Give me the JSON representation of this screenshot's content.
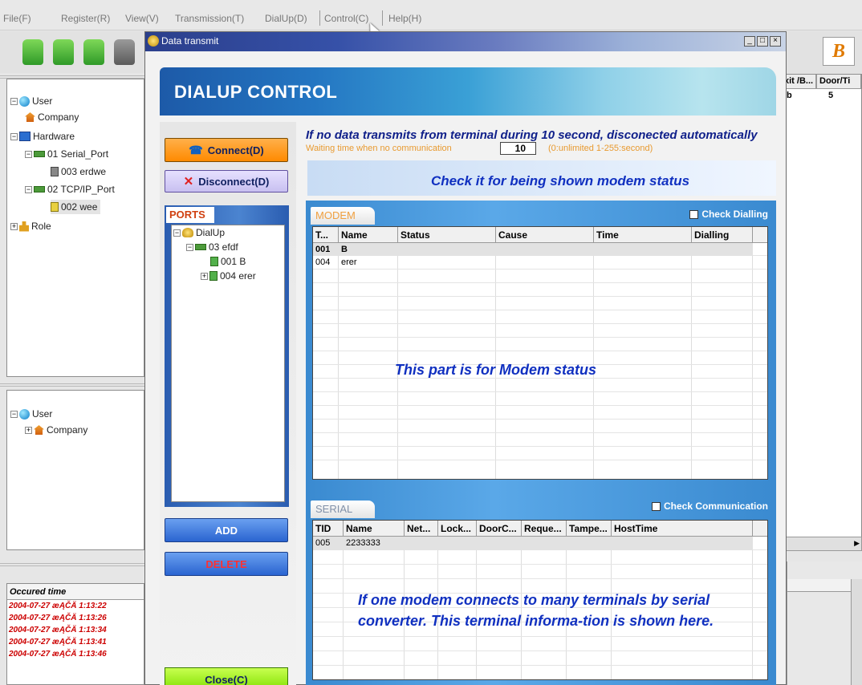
{
  "menubar": {
    "items": [
      "File(F)",
      "Register(R)",
      "View(V)",
      "Transmission(T)",
      "DialUp(D)",
      "Control(C)",
      "Help(H)"
    ]
  },
  "left_tree": {
    "items": [
      "User",
      "Company",
      "Hardware",
      "01 Serial_Port",
      "003 erdwe",
      "02 TCP/IP_Port",
      "002 wee",
      "Role"
    ]
  },
  "left_tree2": {
    "items": [
      "User",
      "Company"
    ]
  },
  "log": {
    "header": "Occured time",
    "rows": [
      "2004-07-27 æĄČÄ 1:13:22",
      "2004-07-27 æĄČÄ 1:13:26",
      "2004-07-27 æĄČÄ 1:13:34",
      "2004-07-27 æĄČÄ 1:13:41",
      "2004-07-27 æĄČÄ 1:13:46"
    ]
  },
  "right_table": {
    "headers": [
      "xit /B...",
      "Door/Ti"
    ],
    "row": [
      "b",
      "5"
    ]
  },
  "dialog": {
    "title": "Data transmit",
    "banner": "DIALUP CONTROL",
    "connect": "Connect(D)",
    "disconnect": "Disconnect(D)",
    "ports_label": "PORTS",
    "ports_tree": [
      "DialUp",
      "03 efdf",
      "001 B",
      "004 erer"
    ],
    "add": "ADD",
    "delete": "DELETE",
    "close": "Close(C)",
    "info": "If no data transmits from terminal during 10 second, disconected automatically",
    "wait_label": "Waiting time when no communication",
    "wait_value": "10",
    "wait_hint": "(0:unlimited 1-255:second)",
    "modem_hint": "Check it for being shown modem status",
    "modem_label": "MODEM",
    "check_dialling": "Check Dialling",
    "modem_columns": [
      "T...",
      "Name",
      "Status",
      "Cause",
      "Time",
      "Dialling"
    ],
    "modem_rows": [
      [
        "001",
        "B",
        "",
        "",
        "",
        ""
      ],
      [
        "004",
        "erer",
        "",
        "",
        "",
        ""
      ]
    ],
    "modem_note": "This part is for Modem status",
    "serial_label": "SERIAL",
    "check_communication": "Check Communication",
    "serial_columns": [
      "TID",
      "Name",
      "Net...",
      "Lock...",
      "DoorC...",
      "Reque...",
      "Tampe...",
      "HostTime"
    ],
    "serial_rows": [
      [
        "005",
        "2233333",
        "",
        "",
        "",
        "",
        "",
        ""
      ]
    ],
    "serial_note": "If one modem connects to many terminals by serial converter. This terminal informa-tion is shown here."
  },
  "brand_logo": "B",
  "colors": {
    "accent": "#ff8a00",
    "note_blue": "#1030c0",
    "log_red": "#cc0000"
  }
}
